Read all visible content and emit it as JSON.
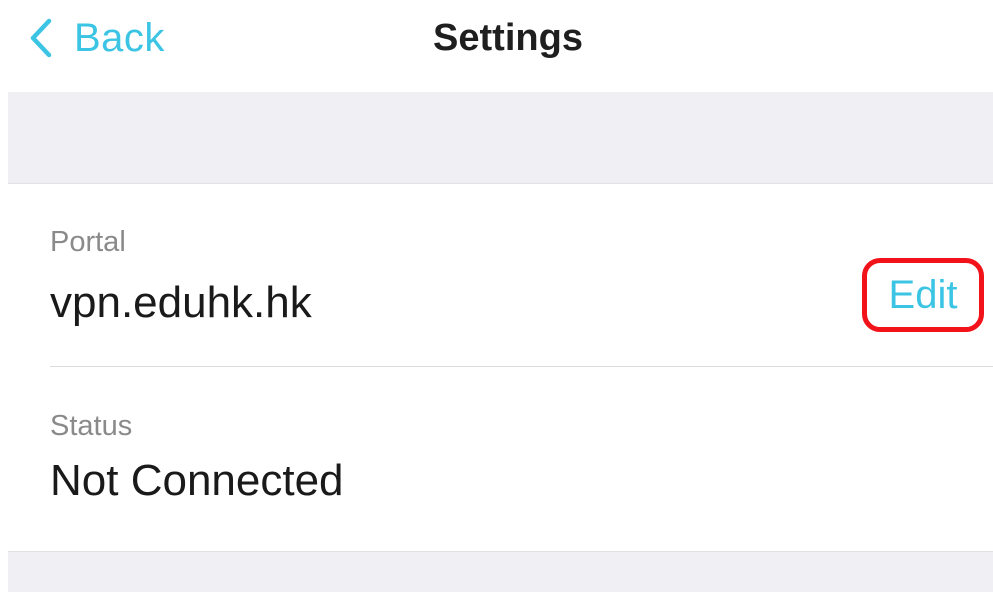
{
  "nav": {
    "back_label": "Back",
    "title": "Settings"
  },
  "portal": {
    "label": "Portal",
    "value": "vpn.eduhk.hk",
    "edit_label": "Edit"
  },
  "status": {
    "label": "Status",
    "value": "Not Connected"
  },
  "colors": {
    "accent": "#3cc4e4",
    "highlight": "#f2121a",
    "grouped_background": "#efeff4"
  },
  "icons": {
    "back": "chevron-left-icon"
  }
}
